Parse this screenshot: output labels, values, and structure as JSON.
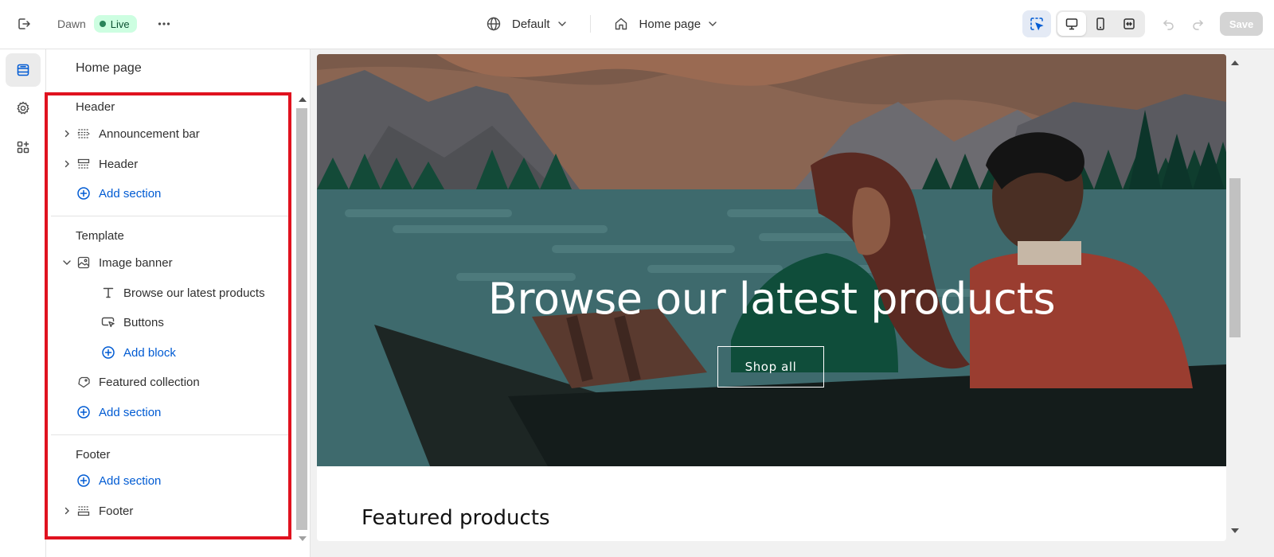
{
  "topbar": {
    "exit_icon": "exit-icon",
    "theme_name": "Dawn",
    "live_badge": "Live",
    "more_icon": "more-horizontal-icon",
    "locale_selector": "Default",
    "page_selector": "Home page",
    "save_label": "Save"
  },
  "rail": {
    "items": [
      "sections-icon",
      "settings-gear-icon",
      "apps-icon"
    ],
    "active": "sections-icon"
  },
  "panel": {
    "title": "Home page",
    "groups": {
      "header": {
        "label": "Header",
        "items": [
          "Announcement bar",
          "Header"
        ],
        "add_label": "Add section"
      },
      "template": {
        "label": "Template",
        "image_banner": "Image banner",
        "blocks": [
          "Browse our latest products",
          "Buttons"
        ],
        "add_block_label": "Add block",
        "featured_collection": "Featured collection",
        "add_label": "Add section"
      },
      "footer": {
        "label": "Footer",
        "add_label": "Add section",
        "items": [
          "Footer"
        ]
      }
    }
  },
  "preview": {
    "banner_heading": "Browse our latest products",
    "banner_button": "Shop all",
    "featured_title": "Featured products"
  },
  "colors": {
    "accent_blue": "#005bd3",
    "live_bg": "#cdfee1",
    "live_dot": "#29845a",
    "highlight": "#e0121f"
  }
}
